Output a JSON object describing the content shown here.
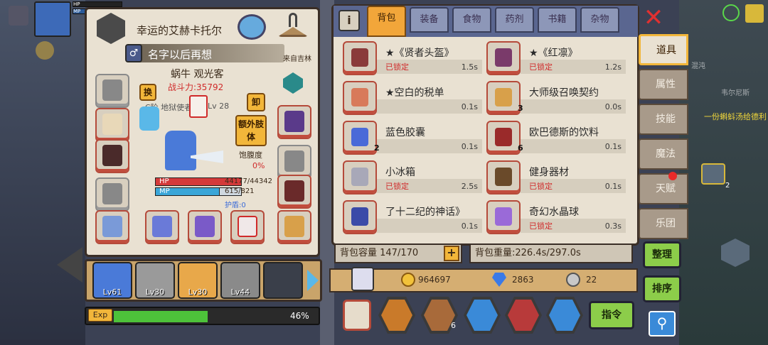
{
  "hud": {
    "hp_label": "HP",
    "hp_value": "44177",
    "mp_label": "MP",
    "level": "61"
  },
  "character": {
    "title": "幸运的艾赫卡托尔",
    "name": "名字以后再想",
    "origin": "来自吉林",
    "species_role": "蜗牛  观光客",
    "power": "战斗力:35792",
    "rank": "C阶 地狱使者",
    "level": "Lv 28",
    "swap_label": "换",
    "unequip_label": "卸",
    "extra_limbs_label": "额外肢体",
    "satiety_label": "饱腹度",
    "satiety_value": "0%",
    "hp_label": "HP",
    "hp_value": "44177/44342",
    "hp_fraction": 0.996,
    "mp_label": "MP",
    "mp_value": "615/821",
    "mp_fraction": 0.749,
    "shield": "护盾:0"
  },
  "party": [
    {
      "lv": "Lv61"
    },
    {
      "lv": "Lv30"
    },
    {
      "lv": "Lv30"
    },
    {
      "lv": "Lv44"
    }
  ],
  "exp": {
    "label": "Exp",
    "value": "46%",
    "fraction": 0.46
  },
  "inventory": {
    "info_icon": "info-icon",
    "tabs": [
      "背包",
      "装备",
      "食物",
      "药剂",
      "书籍",
      "杂物"
    ],
    "active_tab": "背包",
    "items": [
      {
        "name": "★《贤者头盔》",
        "status": "已锁定",
        "weight": "1.5s",
        "count": "",
        "color": "#8a3a3a"
      },
      {
        "name": "★《红凛》",
        "status": "已锁定",
        "weight": "1.2s",
        "count": "",
        "color": "#7a3a6a"
      },
      {
        "name": "★空白的税单",
        "status": "",
        "weight": "0.1s",
        "count": "",
        "color": "#d87a5a"
      },
      {
        "name": "大师级召唤契约",
        "status": "",
        "weight": "0.0s",
        "count": "3",
        "color": "#d8a04a"
      },
      {
        "name": "蓝色胶囊",
        "status": "",
        "weight": "0.1s",
        "count": "2",
        "color": "#4a6ad8"
      },
      {
        "name": "欧巴德斯的饮料",
        "status": "",
        "weight": "0.1s",
        "count": "6",
        "color": "#9a2a2a"
      },
      {
        "name": "小冰箱",
        "status": "已锁定",
        "weight": "2.5s",
        "count": "",
        "color": "#a8a8b8"
      },
      {
        "name": "健身器材",
        "status": "已锁定",
        "weight": "0.1s",
        "count": "",
        "color": "#6a4a2a"
      },
      {
        "name": "了十二纪的神话》",
        "status": "",
        "weight": "0.1s",
        "count": "",
        "color": "#3a4aa8"
      },
      {
        "name": "奇幻水晶球",
        "status": "已锁定",
        "weight": "0.3s",
        "count": "",
        "color": "#9a6ad8"
      }
    ],
    "capacity": "背包容量 147/170",
    "weight": "背包重量:226.4s/297.0s",
    "gold": "964697",
    "gems": "2863",
    "silver": "22",
    "command_label": "指令",
    "bottom_count": "6"
  },
  "side_tabs": [
    "道具",
    "属性",
    "技能",
    "魔法",
    "天赋",
    "乐团"
  ],
  "side_buttons": {
    "arrange": "整理",
    "sort": "排序"
  },
  "bg_text": {
    "label1": "混沌",
    "label2": "韦尔尼斯",
    "label3": "一份蝌蚪汤给德利",
    "lv_hint": "2"
  }
}
